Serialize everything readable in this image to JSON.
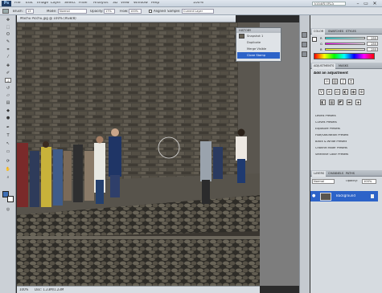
{
  "app": {
    "logo": "Ps",
    "menu": [
      "File",
      "Edit",
      "Image",
      "Layer",
      "Select",
      "Filter",
      "Analysis",
      "3D",
      "View",
      "Window",
      "Help"
    ],
    "zoom": "100%",
    "workspace": "ESSENTIALS",
    "window_controls": [
      "–",
      "▭",
      "✕"
    ]
  },
  "options_bar": {
    "brush_label": "Brush:",
    "brush_size": "13",
    "mode_label": "Mode:",
    "mode_value": "Normal",
    "opacity_label": "Opacity:",
    "opacity_value": "17%",
    "flow_label": "Flow:",
    "flow_value": "100%",
    "aligned_label": "Aligned",
    "sample_label": "Sample:",
    "sample_value": "Current Layer"
  },
  "document": {
    "tab_title": "Machu Picchu.jpg @ 100% (RGB/8)",
    "status_zoom": "100%",
    "status_doc": "Doc: 1.23M/1.23M"
  },
  "history": {
    "header": "HISTORY",
    "items": [
      {
        "label": "Snapshot 1",
        "selected": false
      },
      {
        "label": "Duplicate",
        "selected": false
      },
      {
        "label": "Merge Visible",
        "selected": false
      },
      {
        "label": "Clone Stamp",
        "selected": true
      }
    ]
  },
  "color_panel": {
    "tabs": [
      "COLOR",
      "SWATCHES",
      "STYLES"
    ],
    "r_label": "R",
    "r_value": "255",
    "g_label": "G",
    "g_value": "255",
    "b_label": "B",
    "b_value": "255"
  },
  "adjustments_panel": {
    "tabs": [
      "ADJUSTMENTS",
      "MASKS"
    ],
    "title": "Add an adjustment",
    "presets": [
      "Levels Presets",
      "Curves Presets",
      "Exposure Presets",
      "Hue/Saturation Presets",
      "Black & White Presets",
      "Channel Mixer Presets",
      "Selective Color Presets"
    ]
  },
  "layers_panel": {
    "tabs": [
      "LAYERS",
      "CHANNELS",
      "PATHS"
    ],
    "mode": "Normal",
    "opacity_label": "Opacity:",
    "opacity_value": "100%",
    "layer_name": "Background"
  },
  "colors": {
    "selection": "#2d63c8",
    "foreground": "#3e6fb5"
  }
}
